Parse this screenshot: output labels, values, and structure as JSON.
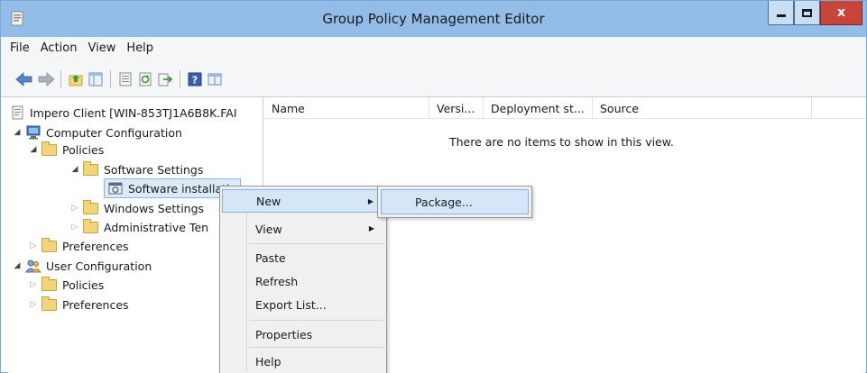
{
  "window": {
    "title": "Group Policy Management Editor",
    "close_glyph": "x"
  },
  "menubar": {
    "items": [
      "File",
      "Action",
      "View",
      "Help"
    ]
  },
  "toolbar": {
    "icons": [
      "back-arrow-icon",
      "forward-arrow-icon",
      "up-folder-icon",
      "show-hide-tree-icon",
      "properties-icon",
      "refresh-icon",
      "export-list-icon",
      "help-icon",
      "console-view-icon"
    ]
  },
  "tree": {
    "root": "Impero Client [WIN-853TJ1A6B8K.FAI",
    "computer_config": "Computer Configuration",
    "policies": "Policies",
    "software_settings": "Software Settings",
    "software_installation": "Software installatio",
    "windows_settings": "Windows Settings",
    "admin_templates": "Administrative Ten",
    "preferences": "Preferences",
    "user_config": "User Configuration",
    "user_policies": "Policies",
    "user_preferences": "Preferences"
  },
  "list": {
    "columns": [
      "Name",
      "Versi...",
      "Deployment st...",
      "Source"
    ],
    "empty_message": "There are no items to show in this view."
  },
  "context_menu": {
    "new": "New",
    "view": "View",
    "paste": "Paste",
    "refresh": "Refresh",
    "export": "Export List...",
    "properties": "Properties",
    "help": "Help"
  },
  "submenu": {
    "package": "Package..."
  },
  "colors": {
    "titlebar": "#93bde8",
    "close_button": "#c8453b",
    "hover": "#d5e6f8"
  }
}
